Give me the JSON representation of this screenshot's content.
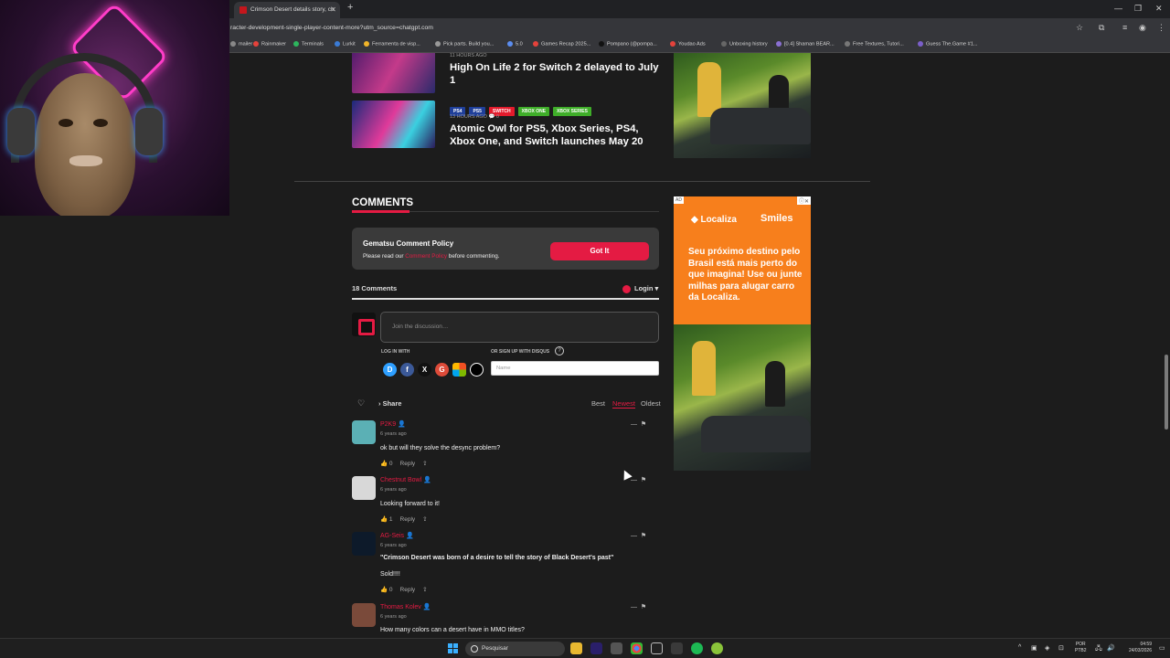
{
  "browser": {
    "tab_title": "Crimson Desert details story, ch",
    "url": "racter-development-single-player-content-more?utm_source=chatgpt.com",
    "bookmarks": [
      {
        "label": "mailer",
        "color": "#888888"
      },
      {
        "label": "Rainmaker",
        "color": "#e4423b"
      },
      {
        "label": "Terminals",
        "color": "#2db55d"
      },
      {
        "label": "Lurkit",
        "color": "#3a7bd5"
      },
      {
        "label": "Ferramenta de visp...",
        "color": "#f0b429"
      },
      {
        "label": "Pick parts. Build you...",
        "color": "#999999"
      },
      {
        "label": "5.0",
        "color": "#5b8def"
      },
      {
        "label": "Games Recap 2025...",
        "color": "#e4423b"
      },
      {
        "label": "Pompano (@pompa...",
        "color": "#111111"
      },
      {
        "label": "Youdao Ads",
        "color": "#e4423b"
      },
      {
        "label": "Unboxing history",
        "color": "#666666"
      },
      {
        "label": "[0.4] Shaman BEAR...",
        "color": "#8a6fd1"
      },
      {
        "label": "Free Textures, Tutori...",
        "color": "#777777"
      },
      {
        "label": "Guess The.Game #1...",
        "color": "#7b5fc9"
      }
    ]
  },
  "articles": [
    {
      "meta": "11 HOURS AGO",
      "title": "High On Life 2 for Switch 2 delayed to July 1",
      "tags": []
    },
    {
      "meta": "13 HOURS AGO",
      "comments": "0",
      "title": "Atomic Owl for PS5, Xbox Series, PS4, Xbox One, and Switch launches May 20",
      "tags": [
        {
          "label": "PS4",
          "color": "#1f3f9a"
        },
        {
          "label": "PS5",
          "color": "#1f3f9a"
        },
        {
          "label": "SWITCH",
          "color": "#e41b2c"
        },
        {
          "label": "XBOX ONE",
          "color": "#3fae29"
        },
        {
          "label": "XBOX SERIES",
          "color": "#3fae29"
        }
      ]
    }
  ],
  "comments_section": {
    "heading": "COMMENTS",
    "policy_title": "Gematsu Comment Policy",
    "policy_pre": "Please read our ",
    "policy_link": "Comment Policy",
    "policy_post": " before commenting.",
    "got_it": "Got It",
    "count": "18 Comments",
    "login": "Login",
    "compose_placeholder": "Join the discussion…",
    "log_in_with": "LOG IN WITH",
    "sign_up_with": "OR SIGN UP WITH DISQUS",
    "name_placeholder": "Name",
    "share": "Share",
    "sort": {
      "best": "Best",
      "newest": "Newest",
      "oldest": "Oldest"
    },
    "social": [
      {
        "letter": "D",
        "color": "#2e9fff"
      },
      {
        "letter": "f",
        "color": "#3b5998"
      },
      {
        "letter": "X",
        "color": "#111111"
      },
      {
        "letter": "G",
        "color": "#dd4b39"
      },
      {
        "letter": "",
        "color": "#ffffff"
      },
      {
        "letter": "",
        "color": "#000000"
      }
    ]
  },
  "comments": [
    {
      "user": "P2K9",
      "date": "6 years ago",
      "text": "ok but will they solve the desync problem?",
      "likes": "0",
      "reply": "Reply",
      "avatar_color": "#5bb0b5"
    },
    {
      "user": "Chestnut Bowl",
      "date": "6 years ago",
      "text": "Looking forward to it!",
      "likes": "1",
      "reply": "Reply",
      "avatar_color": "#d8d8d8"
    },
    {
      "user": "AG-Seis",
      "date": "6 years ago",
      "text": "\"Crimson Desert was born of a desire to tell the story of Black Desert's past\"",
      "text2": "Sold!!!!",
      "likes": "0",
      "reply": "Reply",
      "avatar_color": "#0d1a2a"
    },
    {
      "user": "Thomas Kolev",
      "date": "6 years ago",
      "text": "How many colors can a desert have in MMO titles?",
      "likes": "",
      "reply": "",
      "avatar_color": "#7a4a3a"
    }
  ],
  "ad": {
    "label": "AD",
    "brand1": "Localiza",
    "brand2": "Smiles",
    "copy": "Seu próximo destino pelo Brasil está mais perto do que imagina! Use ou junte milhas para alugar carro da Localiza."
  },
  "taskbar": {
    "search": "Pesquisar",
    "lang1": "POR",
    "lang2": "PTB2",
    "time": "04:59",
    "date": "24/03/2026"
  }
}
